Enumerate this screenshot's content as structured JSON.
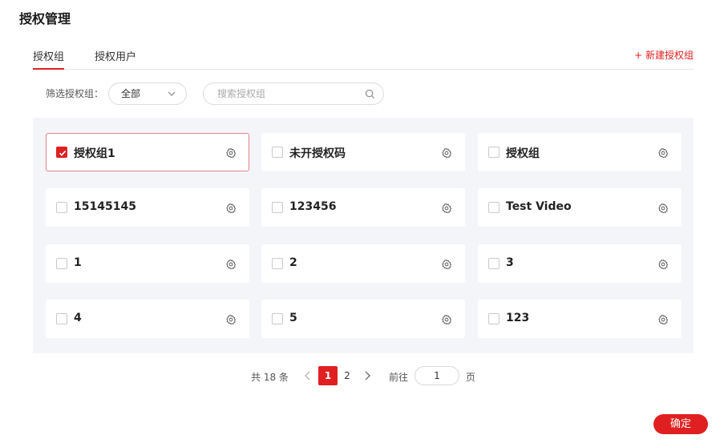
{
  "page": {
    "title": "授权管理"
  },
  "tabs": [
    {
      "label": "授权组",
      "active": true
    },
    {
      "label": "授权用户",
      "active": false
    }
  ],
  "new_group_label": "+ 新建授权组",
  "filter": {
    "label": "筛选授权组：",
    "select_value": "全部",
    "search_placeholder": "搜索授权组"
  },
  "groups": [
    {
      "name": "授权组1",
      "checked": true
    },
    {
      "name": "未开授权码",
      "checked": false
    },
    {
      "name": "授权组",
      "checked": false
    },
    {
      "name": "15145145",
      "checked": false
    },
    {
      "name": "123456",
      "checked": false
    },
    {
      "name": "Test Video",
      "checked": false
    },
    {
      "name": "1",
      "checked": false
    },
    {
      "name": "2",
      "checked": false
    },
    {
      "name": "3",
      "checked": false
    },
    {
      "name": "4",
      "checked": false
    },
    {
      "name": "5",
      "checked": false
    },
    {
      "name": "123",
      "checked": false
    }
  ],
  "pagination": {
    "total_text": "共 18 条",
    "pages": [
      "1",
      "2"
    ],
    "current_page": "1",
    "goto_label": "前往",
    "goto_value": "1",
    "page_unit": "页"
  },
  "confirm_label": "确定",
  "colors": {
    "accent": "#e02020",
    "panel_bg": "#f4f5f9",
    "selected_border": "#e08585"
  },
  "icons": {
    "card_settings": "gear-icon",
    "search": "search-icon",
    "select": "chevron-down-icon",
    "checkbox": "check-icon"
  }
}
